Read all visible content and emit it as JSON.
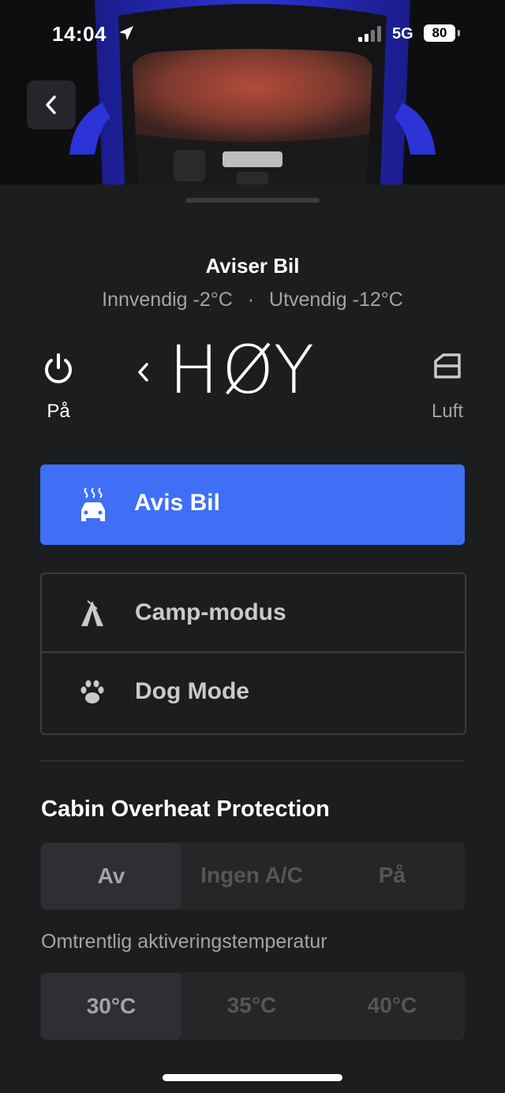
{
  "status_bar": {
    "time": "14:04",
    "network": "5G",
    "battery": "80"
  },
  "header": {
    "title": "Aviser Bil",
    "inside_temp": "Innvendig -2°C",
    "separator": "·",
    "outside_temp": "Utvendig -12°C"
  },
  "climate": {
    "power_label": "På",
    "level": "HØY",
    "vent_label": "Luft"
  },
  "primary_action": {
    "label": "Avis Bil"
  },
  "modes": [
    {
      "label": "Camp-modus"
    },
    {
      "label": "Dog Mode"
    }
  ],
  "cabin_overheat": {
    "title": "Cabin Overheat Protection",
    "options": [
      "Av",
      "Ingen A/C",
      "På"
    ],
    "selected": "Av",
    "activation_label": "Omtrentlig aktiveringstemperatur",
    "temps": [
      "30°C",
      "35°C",
      "40°C"
    ],
    "selected_temp": "30°C"
  },
  "colors": {
    "accent": "#3e6ff5",
    "background": "#1c1d1f",
    "car_body": "#2a2fd0"
  }
}
